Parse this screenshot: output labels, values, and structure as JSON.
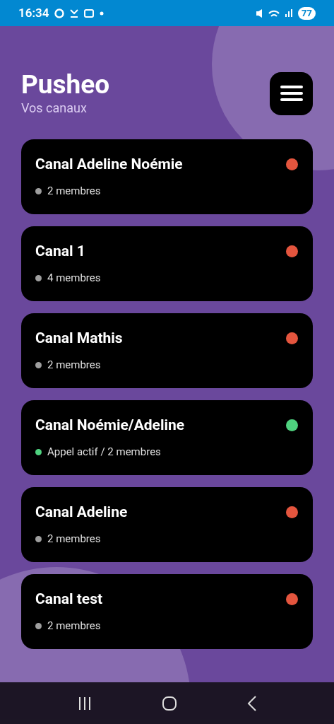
{
  "status_bar": {
    "time": "16:34",
    "battery": "77"
  },
  "header": {
    "title": "Pusheo",
    "subtitle": "Vos canaux"
  },
  "channels": [
    {
      "name": "Canal Adeline Noémie",
      "info": "2 membres",
      "call_active": false
    },
    {
      "name": "Canal 1",
      "info": "4 membres",
      "call_active": false
    },
    {
      "name": "Canal Mathis",
      "info": "2 membres",
      "call_active": false
    },
    {
      "name": "Canal Noémie/Adeline",
      "info": "Appel actif / 2 membres",
      "call_active": true
    },
    {
      "name": "Canal Adeline",
      "info": "2 membres",
      "call_active": false
    },
    {
      "name": "Canal test",
      "info": "2 membres",
      "call_active": false
    }
  ]
}
